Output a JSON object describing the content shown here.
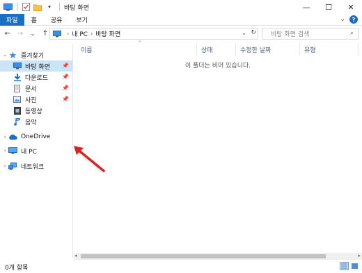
{
  "window": {
    "title": "바탕 화면",
    "controls": {
      "minimize": "—",
      "maximize": "☐",
      "close": "✕"
    }
  },
  "ribbon": {
    "tabs": [
      {
        "label": "파일",
        "active": true
      },
      {
        "label": "홈"
      },
      {
        "label": "공유"
      },
      {
        "label": "보기"
      }
    ],
    "expand_icon": "chevron-down-icon",
    "help_label": "?"
  },
  "nav": {
    "back": "←",
    "forward": "→",
    "recent": "⌄",
    "up": "↑",
    "breadcrumb": [
      "내 PC",
      "바탕 화면"
    ],
    "search_placeholder": "바탕 화면 검색"
  },
  "sidebar": {
    "quick_access": "즐겨찾기",
    "items": [
      {
        "label": "바탕 화면",
        "icon": "desktop-icon",
        "pinned": true,
        "selected": true
      },
      {
        "label": "다운로드",
        "icon": "download-icon",
        "pinned": true
      },
      {
        "label": "문서",
        "icon": "document-icon",
        "pinned": true
      },
      {
        "label": "사진",
        "icon": "pictures-icon",
        "pinned": true
      },
      {
        "label": "동영상",
        "icon": "video-icon"
      },
      {
        "label": "음악",
        "icon": "music-icon"
      }
    ],
    "roots": [
      {
        "label": "OneDrive",
        "icon": "onedrive-cloud-icon"
      },
      {
        "label": "내 PC",
        "icon": "this-pc-icon"
      },
      {
        "label": "네트워크",
        "icon": "network-icon"
      }
    ]
  },
  "content": {
    "columns": [
      "이름",
      "상태",
      "수정한 날짜",
      "유형"
    ],
    "empty_message": "이 폴더는 비어 있습니다."
  },
  "status": {
    "item_count": "0개 항목"
  },
  "colors": {
    "accent": "#1a6fc4",
    "selected_bg": "#cce4f7",
    "annotation_arrow": "#e02020"
  }
}
